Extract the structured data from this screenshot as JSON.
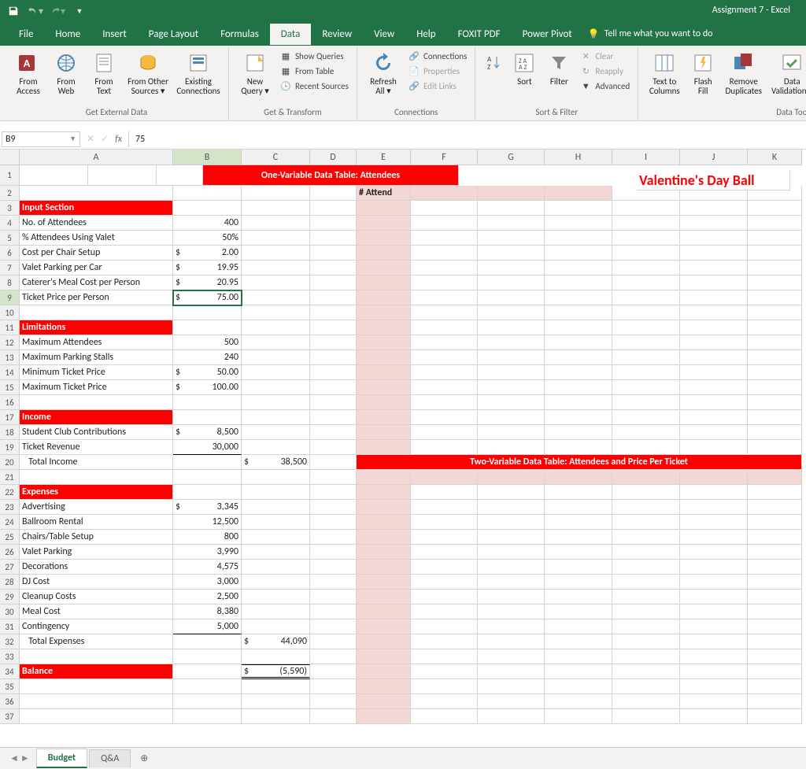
{
  "app_title": "Assignment 7 - Excel",
  "menus": [
    "File",
    "Home",
    "Insert",
    "Page Layout",
    "Formulas",
    "Data",
    "Review",
    "View",
    "Help",
    "FOXIT PDF",
    "Power Pivot"
  ],
  "active_menu": "Data",
  "tellme": "Tell me what you want to do",
  "ribbon": {
    "ged": {
      "label": "Get External Data",
      "from_access": "From Access",
      "from_web": "From Web",
      "from_text": "From Text",
      "from_other": "From Other Sources ▾",
      "existing": "Existing Connections"
    },
    "gt": {
      "label": "Get & Transform",
      "new_query": "New Query ▾",
      "show_queries": "Show Queries",
      "from_table": "From Table",
      "recent": "Recent Sources"
    },
    "conn": {
      "label": "Connections",
      "refresh": "Refresh All ▾",
      "connections": "Connections",
      "properties": "Properties",
      "edit_links": "Edit Links"
    },
    "sf": {
      "label": "Sort & Filter",
      "sort": "Sort",
      "filter": "Filter",
      "clear": "Clear",
      "reapply": "Reapply",
      "advanced": "Advanced"
    },
    "dt": {
      "label": "Data Tools",
      "ttc": "Text to Columns",
      "flash": "Flash Fill",
      "remdup": "Remove Duplicates",
      "dval": "Data Validation ▾"
    }
  },
  "namebox": "B9",
  "formula": "75",
  "cols": {
    "A": 195,
    "B": 87,
    "C": 87,
    "D": 59,
    "E": 69,
    "F": 85,
    "G": 85,
    "H": 86,
    "I": 86,
    "J": 86,
    "K": 69
  },
  "sheet": {
    "title": "Valentine's Day Ball",
    "dt1": "One-Variable Data Table: Attendees",
    "dt2": "Two-Variable Data Table: Attendees and Price Per Ticket",
    "attend": "# Attend",
    "input_hdr": "Input Section",
    "r4": {
      "a": "No. of Attendees",
      "b": "400"
    },
    "r5": {
      "a": "% Attendees Using Valet",
      "b": "50%"
    },
    "r6": {
      "a": "Cost per Chair Setup",
      "b": "2.00"
    },
    "r7": {
      "a": "Valet Parking per Car",
      "b": "19.95"
    },
    "r8": {
      "a": "Caterer's Meal Cost per Person",
      "b": "20.95"
    },
    "r9": {
      "a": "Ticket Price per Person",
      "b": "75.00"
    },
    "lim_hdr": "Limitations",
    "r12": {
      "a": "Maximum Attendees",
      "b": "500"
    },
    "r13": {
      "a": "Maximum Parking Stalls",
      "b": "240"
    },
    "r14": {
      "a": "Minimum Ticket Price",
      "b": "50.00"
    },
    "r15": {
      "a": "Maximum Ticket Price",
      "b": "100.00"
    },
    "inc_hdr": "Income",
    "r18": {
      "a": "Student Club Contributions",
      "b": "8,500"
    },
    "r19": {
      "a": "Ticket Revenue",
      "b": "30,000"
    },
    "r20": {
      "a": "Total Income",
      "c": "38,500"
    },
    "exp_hdr": "Expenses",
    "r23": {
      "a": "Advertising",
      "b": "3,345"
    },
    "r24": {
      "a": "Ballroom Rental",
      "b": "12,500"
    },
    "r25": {
      "a": "Chairs/Table Setup",
      "b": "800"
    },
    "r26": {
      "a": "Valet Parking",
      "b": "3,990"
    },
    "r27": {
      "a": "Decorations",
      "b": "4,575"
    },
    "r28": {
      "a": "DJ Cost",
      "b": "3,000"
    },
    "r29": {
      "a": "Cleanup Costs",
      "b": "2,500"
    },
    "r30": {
      "a": "Meal Cost",
      "b": "8,380"
    },
    "r31": {
      "a": "Contingency",
      "b": "5,000"
    },
    "r32": {
      "a": "Total Expenses",
      "c": "44,090"
    },
    "bal_hdr": "Balance",
    "r34": {
      "c": "(5,590)"
    },
    "dollar": "$"
  },
  "tabs": {
    "budget": "Budget",
    "qa": "Q&A"
  }
}
